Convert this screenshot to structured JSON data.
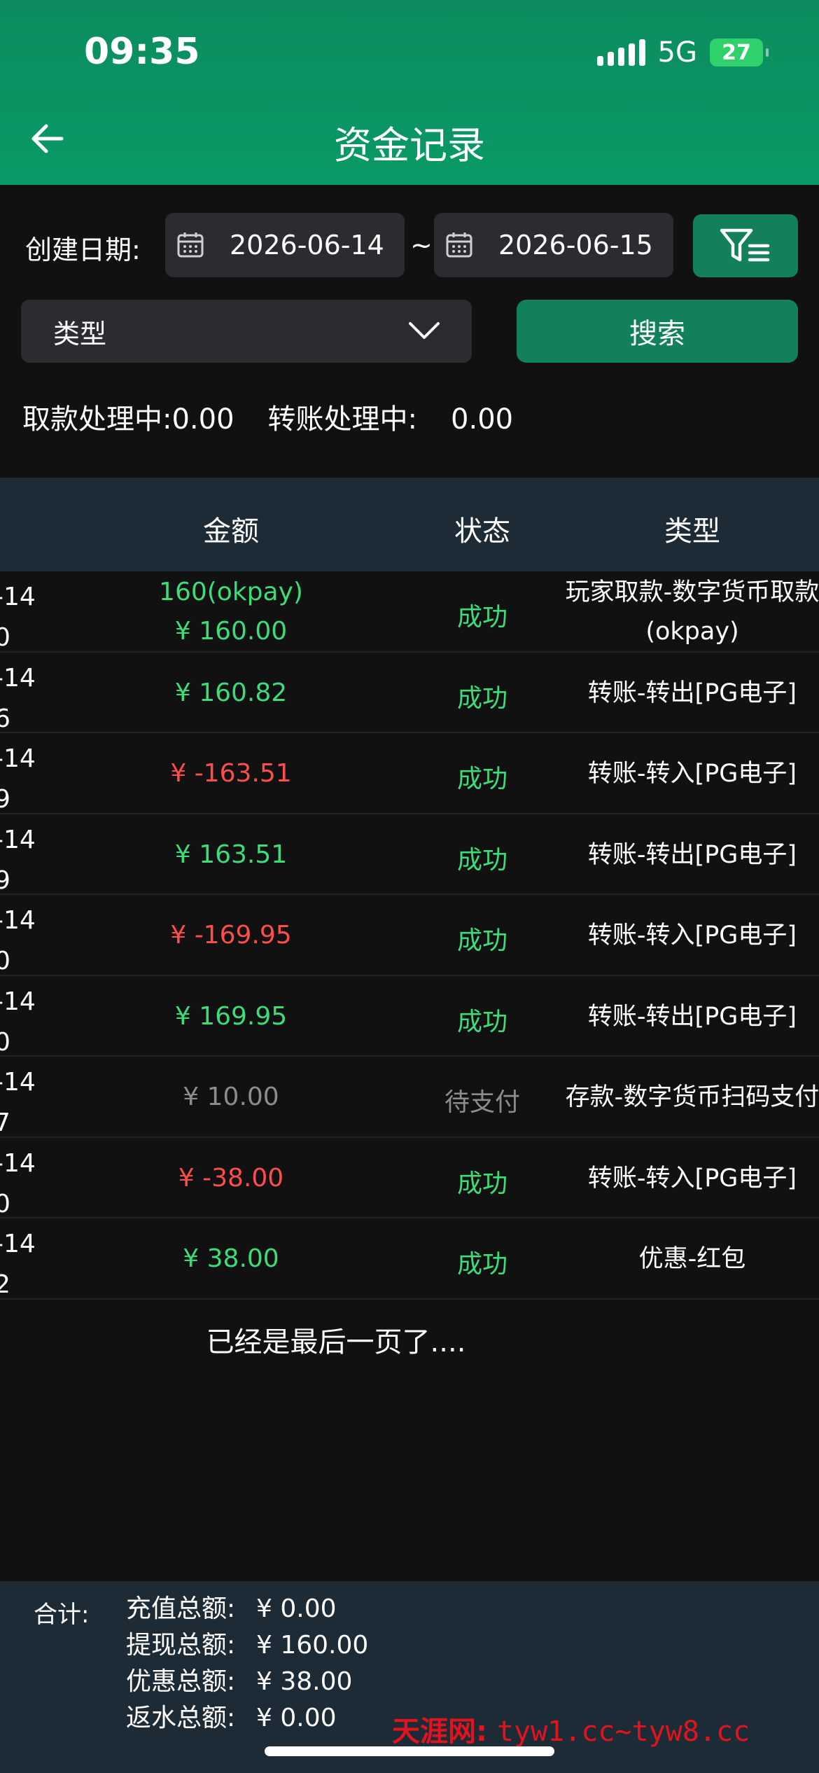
{
  "status_bar": {
    "time": "09:35",
    "network": "5G",
    "battery": "27"
  },
  "header": {
    "title": "资金记录"
  },
  "filters": {
    "date_label": "创建日期:",
    "date_start": "2026-06-14",
    "tilde": "~",
    "date_end": "2026-06-15",
    "type_label": "类型",
    "search_label": "搜索"
  },
  "processing": {
    "withdraw_label": "取款处理中:",
    "withdraw_value": "0.00",
    "transfer_label": "转账处理中:",
    "transfer_value": "0.00"
  },
  "table": {
    "headers": {
      "amount": "金额",
      "status": "状态",
      "type": "类型"
    },
    "rows": [
      {
        "date_top": "-14",
        "date_bottom": "0",
        "amount_line1": "160(okpay)",
        "amount": "¥ 160.00",
        "amount_color": "#3ddc7a",
        "status": "成功",
        "status_color": "#3ddc7a",
        "type": "玩家取款-数字货币取款(okpay)"
      },
      {
        "date_top": "-14",
        "date_bottom": "6",
        "amount": "¥ 160.82",
        "amount_color": "#3ddc7a",
        "status": "成功",
        "status_color": "#3ddc7a",
        "type": "转账-转出[PG电子]"
      },
      {
        "date_top": "-14",
        "date_bottom": "9",
        "amount": "¥ -163.51",
        "amount_color": "#ff4d4d",
        "status": "成功",
        "status_color": "#3ddc7a",
        "type": "转账-转入[PG电子]"
      },
      {
        "date_top": "-14",
        "date_bottom": "9",
        "amount": "¥ 163.51",
        "amount_color": "#3ddc7a",
        "status": "成功",
        "status_color": "#3ddc7a",
        "type": "转账-转出[PG电子]"
      },
      {
        "date_top": "-14",
        "date_bottom": "0",
        "amount": "¥ -169.95",
        "amount_color": "#ff4d4d",
        "status": "成功",
        "status_color": "#3ddc7a",
        "type": "转账-转入[PG电子]"
      },
      {
        "date_top": "-14",
        "date_bottom": "0",
        "amount": "¥ 169.95",
        "amount_color": "#3ddc7a",
        "status": "成功",
        "status_color": "#3ddc7a",
        "type": "转账-转出[PG电子]"
      },
      {
        "date_top": "-14",
        "date_bottom": "7",
        "amount": "¥ 10.00",
        "amount_color": "#8a8d90",
        "status": "待支付",
        "status_color": "#8a8d90",
        "type": "存款-数字货币扫码支付"
      },
      {
        "date_top": "-14",
        "date_bottom": "0",
        "amount": "¥ -38.00",
        "amount_color": "#ff4d4d",
        "status": "成功",
        "status_color": "#3ddc7a",
        "type": "转账-转入[PG电子]"
      },
      {
        "date_top": "-14",
        "date_bottom": "2",
        "amount": "¥ 38.00",
        "amount_color": "#3ddc7a",
        "status": "成功",
        "status_color": "#3ddc7a",
        "type": "优惠-红包"
      }
    ],
    "end_text": "已经是最后一页了...."
  },
  "totals": {
    "label": "合计:",
    "items": [
      {
        "key": "充值总额:",
        "value": "¥ 0.00"
      },
      {
        "key": "提现总额:",
        "value": "¥ 160.00"
      },
      {
        "key": "优惠总额:",
        "value": "¥ 38.00"
      },
      {
        "key": "返水总额:",
        "value": "¥ 0.00"
      }
    ]
  },
  "watermark": {
    "brand": "天涯网:",
    "site": "tyw1.cc~tyw8.cc"
  },
  "colors": {
    "accent": "#12805a",
    "header": "#0a9a66",
    "success": "#3ddc7a",
    "negative": "#ff4d4d",
    "pending": "#8a8d90"
  }
}
